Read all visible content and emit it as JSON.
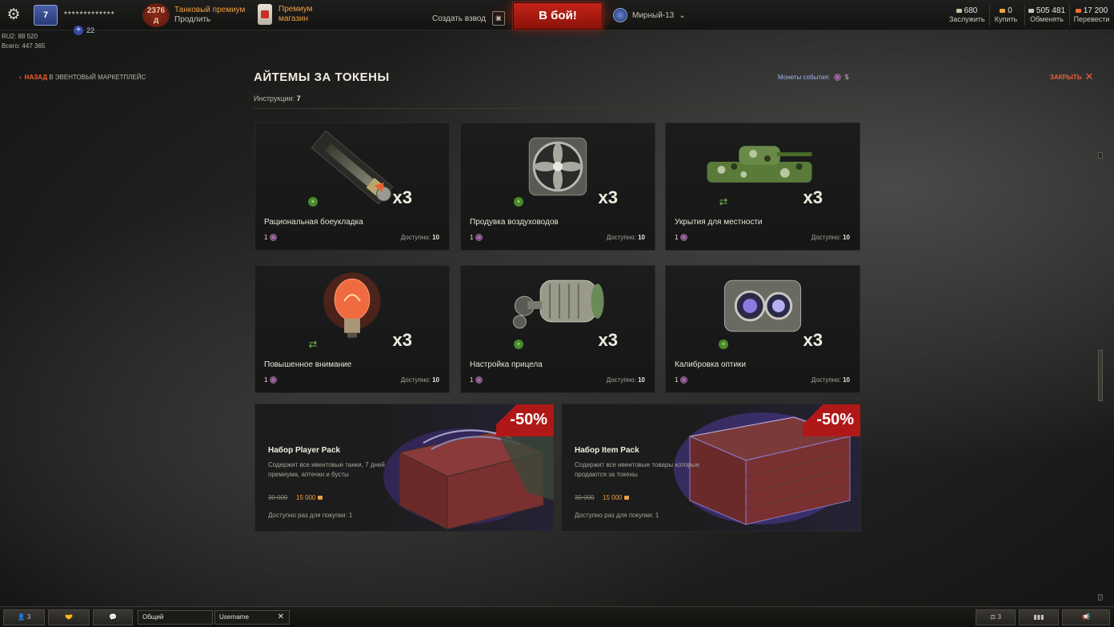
{
  "topbar": {
    "username": "*************",
    "rank_label": "7",
    "level": "22",
    "stats": {
      "ru2": "RU2: 88 520",
      "total": "Всего: 447 365"
    },
    "premium": {
      "days": "2376",
      "days_sub": "д",
      "title": "Танковый премиум",
      "action": "Продлить"
    },
    "shop": {
      "line1": "Премиум",
      "line2": "магазин"
    },
    "platoon_label": "Создать взвод",
    "battle_label": "В бой!",
    "mode_label": "Мирный-13",
    "currencies": [
      {
        "value": "680",
        "label": "Заслужить",
        "color": "#c8c4a0"
      },
      {
        "value": "0",
        "label": "Купить",
        "color": "#f0a040"
      },
      {
        "value": "505 481",
        "label": "Обменять",
        "color": "#c8c4b8"
      },
      {
        "value": "17 200",
        "label": "Перевести",
        "color": "#f06a30"
      }
    ]
  },
  "header": {
    "back_bold": "НАЗАД",
    "back_rest": " В ЭВЕНТОВЫЙ МАРКЕТПЛЕЙС",
    "title": "АЙТЕМЫ ЗА ТОКЕНЫ",
    "instructions_label": "Инструкции:",
    "instructions_value": "7",
    "event_coins_label": "Монеты события:",
    "event_coins_value": "5",
    "close_label": "ЗАКРЫТЬ"
  },
  "cards": [
    {
      "name": "Рациональная боеукладка",
      "mult": "x3",
      "price": "1",
      "avail_label": "Доступно:",
      "avail": "10",
      "kind": "plus",
      "icon": "ammo-icon"
    },
    {
      "name": "Продувка воздуховодов",
      "mult": "x3",
      "price": "1",
      "avail_label": "Доступно:",
      "avail": "10",
      "kind": "plus",
      "icon": "fan-icon"
    },
    {
      "name": "Укрытия для местности",
      "mult": "x3",
      "price": "1",
      "avail_label": "Доступно:",
      "avail": "10",
      "kind": "refresh",
      "icon": "camo-tank-icon"
    },
    {
      "name": "Повышенное внимание",
      "mult": "x3",
      "price": "1",
      "avail_label": "Доступно:",
      "avail": "10",
      "kind": "refresh",
      "icon": "bulb-icon"
    },
    {
      "name": "Настройка прицела",
      "mult": "x3",
      "price": "1",
      "avail_label": "Доступно:",
      "avail": "10",
      "kind": "plus",
      "icon": "motor-icon"
    },
    {
      "name": "Калибровка оптики",
      "mult": "x3",
      "price": "1",
      "avail_label": "Доступно:",
      "avail": "10",
      "kind": "plus",
      "icon": "optics-icon"
    }
  ],
  "bundles": [
    {
      "name": "Набор Player Pack",
      "desc": "Содержит все ивентовые танки, 7 дней премиума, аптечки и бусты",
      "old_price": "30 000",
      "new_price": "15 000",
      "avail": "Доступно раз для покупки: 1",
      "discount": "-50%"
    },
    {
      "name": "Набор Item Pack",
      "desc": "Содержит все ивентовые товары которые продаются за токены",
      "old_price": "30 000",
      "new_price": "15 000",
      "avail": "Доступно раз для покупки: 1",
      "discount": "-50%"
    }
  ],
  "bottombar": {
    "friends_count": "3",
    "chat_tab_1": "Общий",
    "chat_tab_2": "Username",
    "right_count": "3"
  }
}
